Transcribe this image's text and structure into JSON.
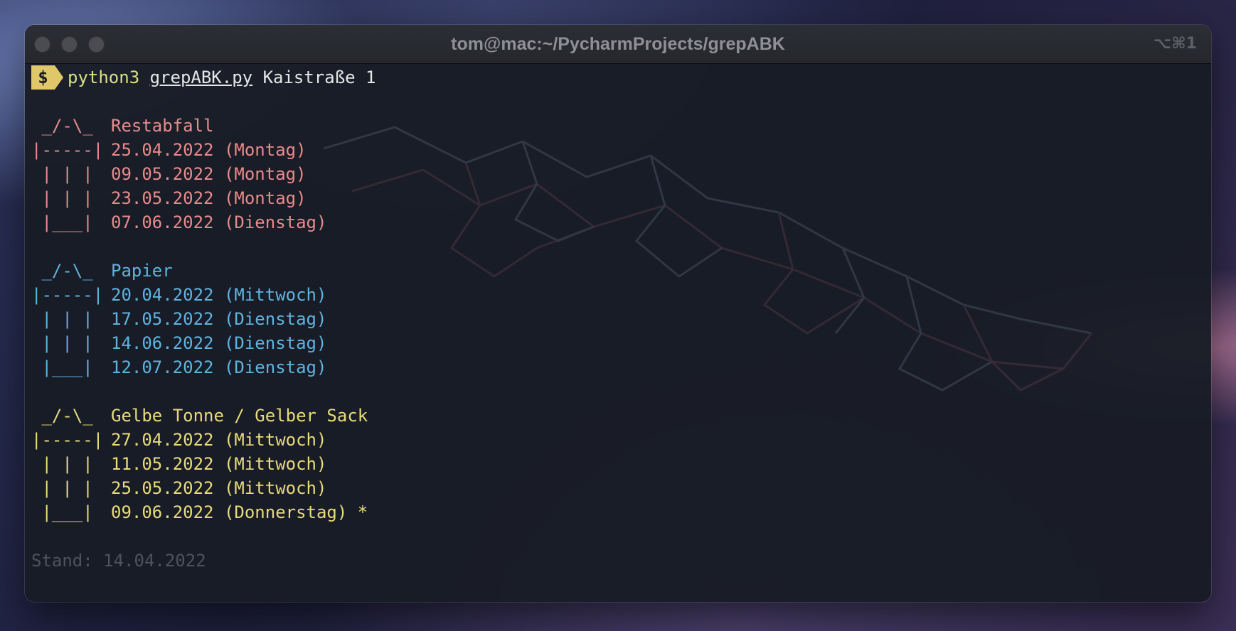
{
  "window": {
    "title": "tom@mac:~/PycharmProjects/grepABK",
    "shortcut": "⌥⌘1"
  },
  "prompt": {
    "symbol": "$",
    "command": "python3",
    "script": "grepABK.py",
    "args": "Kaistraße 1"
  },
  "bins": [
    {
      "name": "Restabfall",
      "color": "#e88b8b",
      "art": [
        " _/-\\_ ",
        "|-----|",
        " | | | ",
        " | | | ",
        " |___| "
      ],
      "dates": [
        "25.04.2022 (Montag)",
        "09.05.2022 (Montag)",
        "23.05.2022 (Montag)",
        "07.06.2022 (Dienstag)"
      ]
    },
    {
      "name": "Papier",
      "color": "#5fb4e0",
      "art": [
        " _/-\\_ ",
        "|-----|",
        " | | | ",
        " | | | ",
        " |___| "
      ],
      "dates": [
        "20.04.2022 (Mittwoch)",
        "17.05.2022 (Dienstag)",
        "14.06.2022 (Dienstag)",
        "12.07.2022 (Dienstag)"
      ]
    },
    {
      "name": "Gelbe Tonne / Gelber Sack",
      "color": "#e8db7c",
      "art": [
        " _/-\\_ ",
        "|-----|",
        " | | | ",
        " | | | ",
        " |___| "
      ],
      "dates": [
        "27.04.2022 (Mittwoch)",
        "11.05.2022 (Mittwoch)",
        "25.05.2022 (Mittwoch)",
        "09.06.2022 (Donnerstag) *"
      ]
    }
  ],
  "footer": "Stand: 14.04.2022"
}
